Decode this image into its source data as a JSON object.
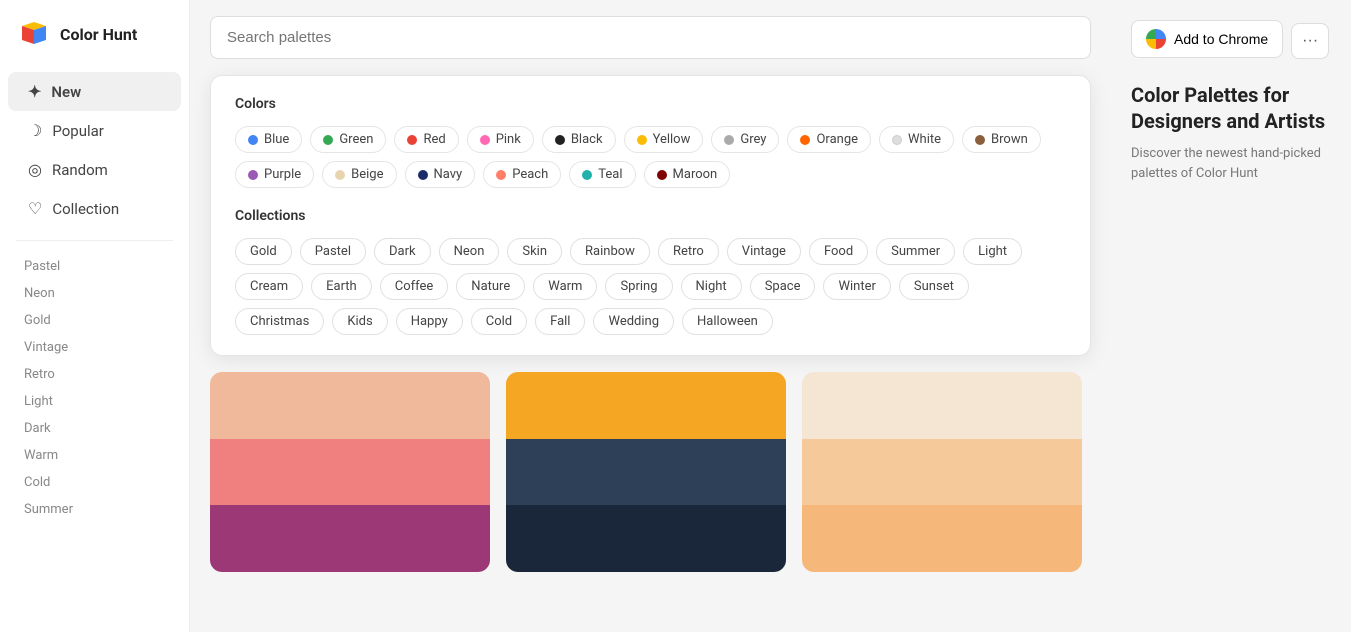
{
  "logo": {
    "text": "Color Hunt"
  },
  "nav": {
    "items": [
      {
        "label": "New",
        "icon": "✦",
        "active": true
      },
      {
        "label": "Popular",
        "icon": "☽"
      },
      {
        "label": "Random",
        "icon": "◎"
      },
      {
        "label": "Collection",
        "icon": "♡"
      }
    ]
  },
  "sidebar_tags": [
    "Pastel",
    "Neon",
    "Gold",
    "Vintage",
    "Retro",
    "Light",
    "Dark",
    "Warm",
    "Cold",
    "Summer"
  ],
  "search": {
    "placeholder": "Search palettes"
  },
  "colors_section": {
    "title": "Colors",
    "items": [
      {
        "label": "Blue",
        "color": "#4285F4"
      },
      {
        "label": "Green",
        "color": "#34A853"
      },
      {
        "label": "Red",
        "color": "#EA4335"
      },
      {
        "label": "Pink",
        "color": "#FF69B4"
      },
      {
        "label": "Black",
        "color": "#222222"
      },
      {
        "label": "Yellow",
        "color": "#FBBC05"
      },
      {
        "label": "Grey",
        "color": "#AAAAAA"
      },
      {
        "label": "Orange",
        "color": "#FF6600"
      },
      {
        "label": "White",
        "color": "#DDDDDD"
      },
      {
        "label": "Brown",
        "color": "#8B5E3C"
      },
      {
        "label": "Purple",
        "color": "#9B59B6"
      },
      {
        "label": "Beige",
        "color": "#E8D5B0"
      },
      {
        "label": "Navy",
        "color": "#1B2A6B"
      },
      {
        "label": "Peach",
        "color": "#FF7F6A"
      },
      {
        "label": "Teal",
        "color": "#20B2AA"
      },
      {
        "label": "Maroon",
        "color": "#800000"
      }
    ]
  },
  "collections_section": {
    "title": "Collections",
    "items": [
      "Gold",
      "Pastel",
      "Dark",
      "Neon",
      "Skin",
      "Rainbow",
      "Retro",
      "Vintage",
      "Food",
      "Summer",
      "Light",
      "Cream",
      "Earth",
      "Coffee",
      "Nature",
      "Warm",
      "Spring",
      "Night",
      "Space",
      "Winter",
      "Sunset",
      "Christmas",
      "Kids",
      "Happy",
      "Cold",
      "Fall",
      "Wedding",
      "Halloween"
    ]
  },
  "palettes": [
    {
      "swatches": [
        "#F0B99B",
        "#F08080",
        "#9B3875"
      ]
    },
    {
      "swatches": [
        "#F5A623",
        "#2E4057",
        "#1A2639"
      ]
    },
    {
      "swatches": [
        "#F5E6D3",
        "#F5C99A",
        "#F5B87A"
      ]
    }
  ],
  "right_panel": {
    "chrome_label": "Add to Chrome",
    "more_label": "···",
    "promo_title": "Color Palettes for Designers and Artists",
    "promo_desc": "Discover the newest hand-picked palettes of Color Hunt"
  }
}
